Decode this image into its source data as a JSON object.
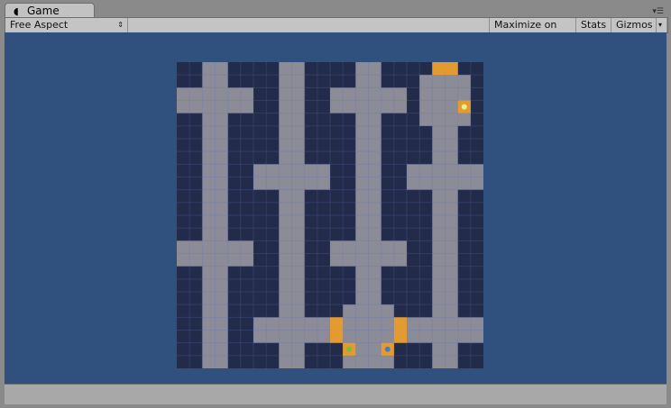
{
  "tab": {
    "title": "Game",
    "icon": "pacman-icon"
  },
  "toolbar": {
    "aspect": "Free Aspect",
    "maximize": "Maximize on Play",
    "stats": "Stats",
    "gizmos": "Gizmos"
  },
  "colors": {
    "background": "#30507e",
    "floor": "#8c8c98",
    "wall": "#232b4a",
    "door": "#e39a30",
    "grid": "#5a6fb8"
  }
}
